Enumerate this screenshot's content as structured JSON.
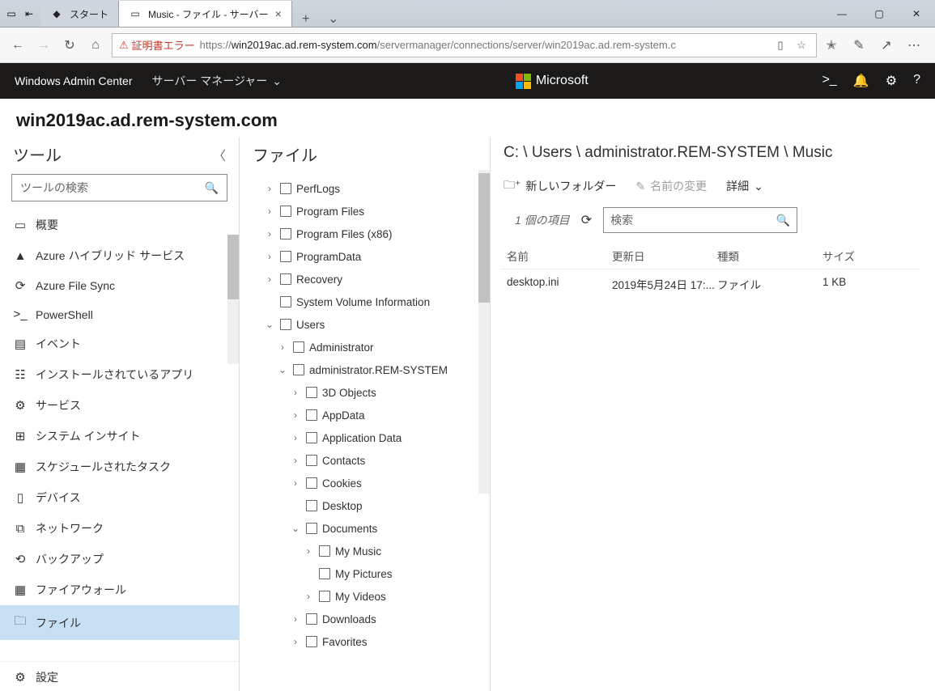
{
  "titlebar": {
    "tab_inactive": "スタート",
    "tab_active": "Music - ファイル - サーバー"
  },
  "address": {
    "cert_error": "証明書エラー",
    "url_prefix": "https://",
    "url_host": "win2019ac.ad.rem-system.com",
    "url_rest": "/servermanager/connections/server/win2019ac.ad.rem-system.c"
  },
  "wac": {
    "brand": "Windows Admin Center",
    "crumb": "サーバー マネージャー",
    "ms": "Microsoft"
  },
  "host": "win2019ac.ad.rem-system.com",
  "sidebar": {
    "title": "ツール",
    "search_ph": "ツールの検索",
    "items": [
      "概要",
      "Azure ハイブリッド サービス",
      "Azure File Sync",
      "PowerShell",
      "イベント",
      "インストールされているアプリ",
      "サービス",
      "システム インサイト",
      "スケジュールされたタスク",
      "デバイス",
      "ネットワーク",
      "バックアップ",
      "ファイアウォール",
      "ファイル"
    ],
    "settings": "設定"
  },
  "tree": {
    "title": "ファイル",
    "nodes": [
      {
        "d": 0,
        "e": ">",
        "t": "PerfLogs"
      },
      {
        "d": 0,
        "e": ">",
        "t": "Program Files"
      },
      {
        "d": 0,
        "e": ">",
        "t": "Program Files (x86)"
      },
      {
        "d": 0,
        "e": ">",
        "t": "ProgramData"
      },
      {
        "d": 0,
        "e": ">",
        "t": "Recovery"
      },
      {
        "d": 0,
        "e": "",
        "t": "System Volume Information"
      },
      {
        "d": 0,
        "e": "v",
        "t": "Users"
      },
      {
        "d": 1,
        "e": ">",
        "t": "Administrator"
      },
      {
        "d": 1,
        "e": "v",
        "t": "administrator.REM-SYSTEM"
      },
      {
        "d": 2,
        "e": ">",
        "t": "3D Objects"
      },
      {
        "d": 2,
        "e": ">",
        "t": "AppData"
      },
      {
        "d": 2,
        "e": ">",
        "t": "Application Data"
      },
      {
        "d": 2,
        "e": ">",
        "t": "Contacts"
      },
      {
        "d": 2,
        "e": ">",
        "t": "Cookies"
      },
      {
        "d": 2,
        "e": "",
        "t": "Desktop"
      },
      {
        "d": 2,
        "e": "v",
        "t": "Documents"
      },
      {
        "d": 3,
        "e": ">",
        "t": "My Music"
      },
      {
        "d": 3,
        "e": "",
        "t": "My Pictures"
      },
      {
        "d": 3,
        "e": ">",
        "t": "My Videos"
      },
      {
        "d": 2,
        "e": ">",
        "t": "Downloads"
      },
      {
        "d": 2,
        "e": ">",
        "t": "Favorites"
      }
    ]
  },
  "main": {
    "breadcrumb": "C: \\ Users \\ administrator.REM-SYSTEM \\ Music",
    "cmd_newfolder": "新しいフォルダー",
    "cmd_rename": "名前の変更",
    "cmd_details": "詳細",
    "count": "1 個の項目",
    "search_ph": "検索",
    "cols": {
      "name": "名前",
      "date": "更新日",
      "type": "種類",
      "size": "サイズ"
    },
    "rows": [
      {
        "name": "desktop.ini",
        "date": "2019年5月24日 17:...",
        "type": "ファイル",
        "size": "1 KB"
      }
    ]
  }
}
